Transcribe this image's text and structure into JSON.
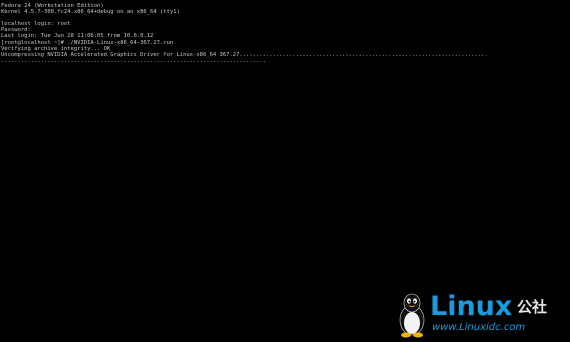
{
  "console": {
    "lines": [
      "Fedora 24 (Workstation Edition)",
      "Kernel 4.5.7-300.fc24.x86_64+debug on an x86_64 (tty1)",
      "",
      "localhost login: root",
      "Password:",
      "Last login: Tue Jun 28 11:06:05 from 10.0.0.12",
      "[root@localhost ~]# ./NVIDIA-Linux-x86_64-367.27.run",
      "Verifying archive integrity... OK",
      "Uncompressing NVIDIA Accelerated Graphics Driver for Linux-x86_64 367.27...........................................................................",
      "................................................................................"
    ]
  },
  "watermark": {
    "logo_text": "Linux",
    "suffix": "公社",
    "url": "www.Linuxidc.com",
    "icon": "tux-penguin-icon",
    "accent_color": "#1a9be0"
  }
}
